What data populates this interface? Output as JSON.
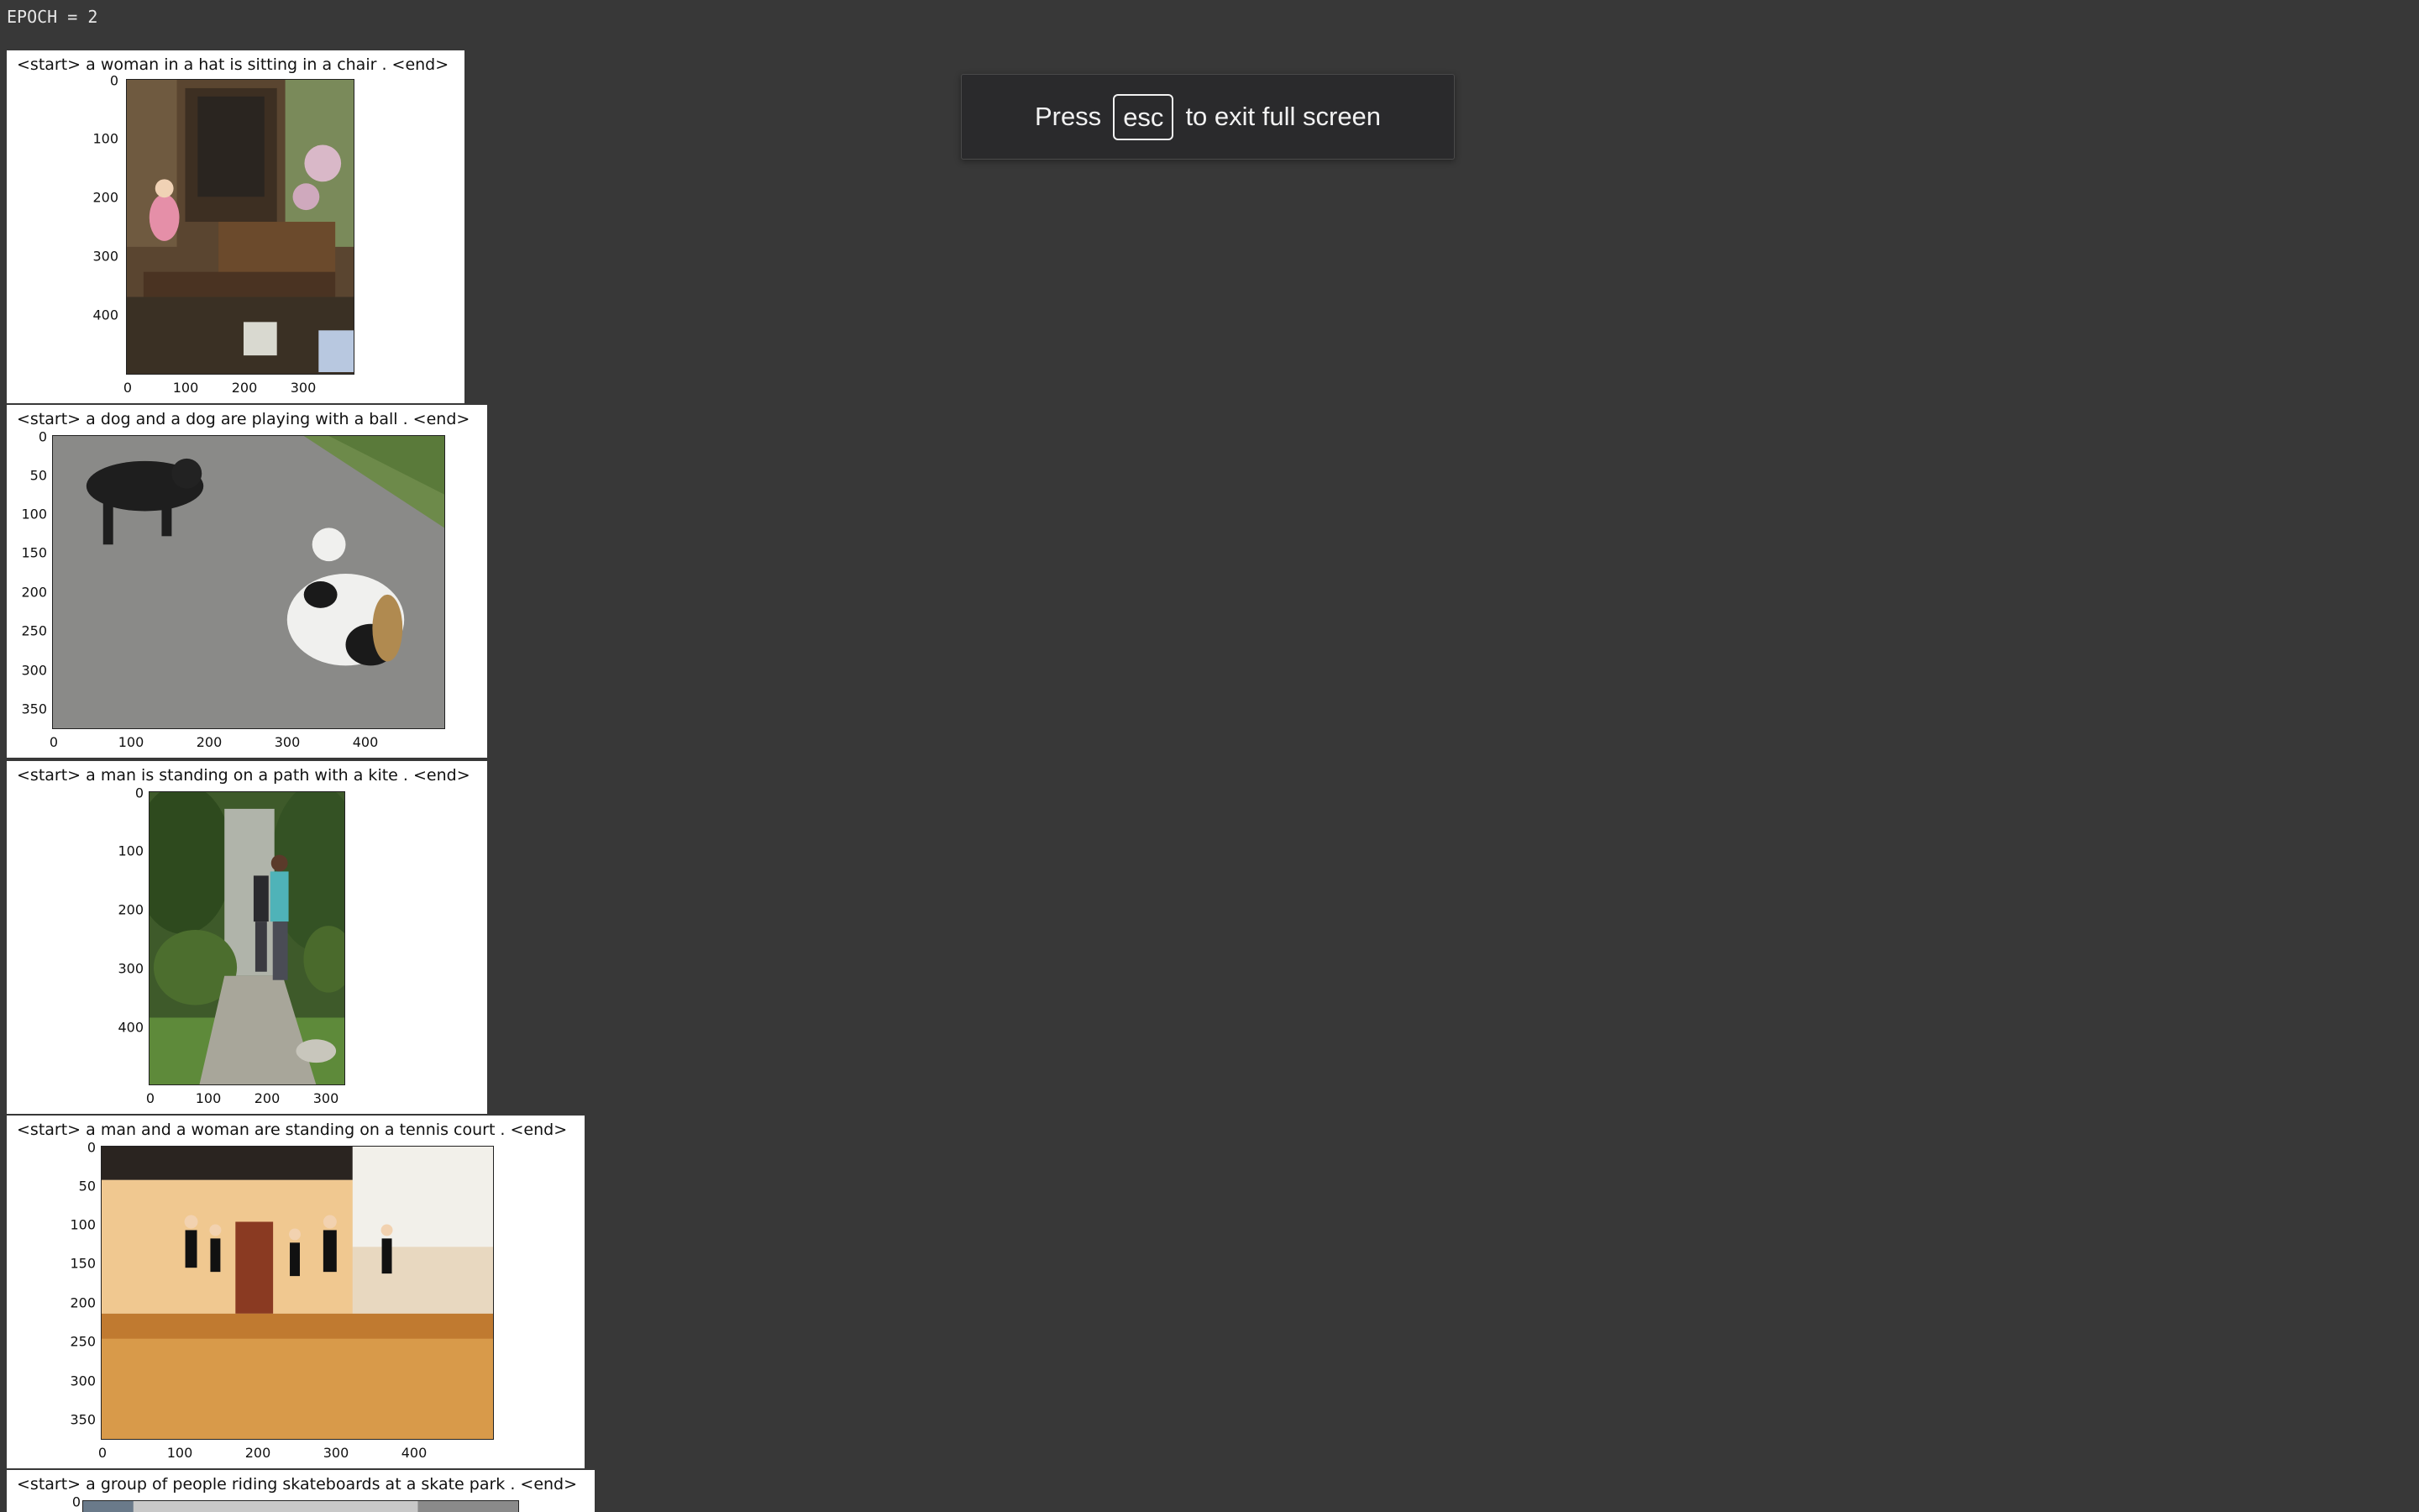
{
  "header": {
    "epoch_label": "EPOCH = 2"
  },
  "fullscreen_toast": {
    "prefix": "Press",
    "key": "esc",
    "suffix": "to exit full screen"
  },
  "outputs": [
    {
      "caption": "<start> a woman in a hat is sitting in a chair . <end>",
      "image_description": "child in pink dress climbing wooden steps",
      "y_ticks": [
        "0",
        "100",
        "200",
        "300",
        "400"
      ],
      "x_ticks": [
        "0",
        "100",
        "200",
        "300"
      ]
    },
    {
      "caption": "<start> a dog and a dog are playing with a ball . <end>",
      "image_description": "two dogs playing on road",
      "y_ticks": [
        "0",
        "50",
        "100",
        "150",
        "200",
        "250",
        "300",
        "350"
      ],
      "x_ticks": [
        "0",
        "100",
        "200",
        "300",
        "400"
      ]
    },
    {
      "caption": "<start> a man is standing on a path with a kite . <end>",
      "image_description": "couple in garden path",
      "y_ticks": [
        "0",
        "100",
        "200",
        "300",
        "400"
      ],
      "x_ticks": [
        "0",
        "100",
        "200",
        "300"
      ]
    },
    {
      "caption": "<start> a man and a woman are standing on a tennis court . <end>",
      "image_description": "ballet dancers in studio",
      "y_ticks": [
        "0",
        "50",
        "100",
        "150",
        "200",
        "250",
        "300",
        "350"
      ],
      "x_ticks": [
        "0",
        "100",
        "200",
        "300",
        "400"
      ]
    },
    {
      "caption": "<start> a group of people riding skateboards at a skate park . <end>",
      "image_description": "partially visible image",
      "y_ticks": [
        "0"
      ],
      "x_ticks": []
    }
  ]
}
